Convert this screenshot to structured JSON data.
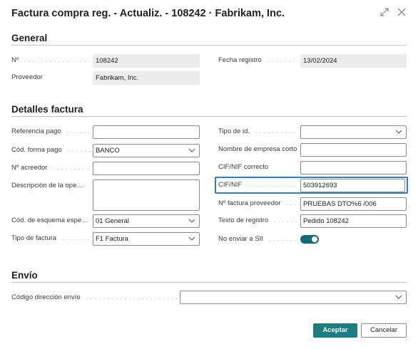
{
  "window": {
    "title": "Factura compra reg. - Actualiz. - 108242 · Fabrikam, Inc."
  },
  "icons": {
    "expand": "expand-icon",
    "close": "close-icon",
    "dropdown": "chevron-down-icon"
  },
  "colors": {
    "accent": "#1c7e82",
    "focus": "#2e7fc4",
    "toggle_on": "#0f6e73"
  },
  "general": {
    "title": "General",
    "no_label": "Nº",
    "no_value": "108242",
    "fecha_label": "Fecha registro",
    "fecha_value": "13/02/2024",
    "proveedor_label": "Proveedor",
    "proveedor_value": "Fabrikam, Inc."
  },
  "detalles": {
    "title": "Detalles factura",
    "referencia_pago": {
      "label": "Referencia pago",
      "value": ""
    },
    "cod_forma_pago": {
      "label": "Cód. forma pago",
      "value": "BANCO"
    },
    "no_acreedor": {
      "label": "Nº acreedor",
      "value": ""
    },
    "descripcion": {
      "label": "Descripción de la operación",
      "value": ""
    },
    "cod_esquema": {
      "label": "Cód. de esquema especial",
      "value": "01 General"
    },
    "tipo_factura": {
      "label": "Tipo de factura",
      "value": "F1 Factura"
    },
    "tipo_id": {
      "label": "Tipo de id.",
      "value": ""
    },
    "nombre_empresa": {
      "label": "Nombre de empresa corto",
      "value": ""
    },
    "cif_correcto": {
      "label": "CIF/NIF correcto",
      "value": ""
    },
    "cif_nif": {
      "label": "CIF/NIF",
      "value": "503912693"
    },
    "no_factura_proveedor": {
      "label": "Nº factura proveedor",
      "value": "PRUEBAS DTO%6 /006"
    },
    "texto_registro": {
      "label": "Texto de registro",
      "value": "Pedido 108242"
    },
    "no_enviar_sii": {
      "label": "No enviar a SII",
      "value": true
    }
  },
  "envio": {
    "title": "Envío",
    "codigo_direccion": {
      "label": "Código dirección envío",
      "value": ""
    }
  },
  "buttons": {
    "accept": "Aceptar",
    "cancel": "Cancelar"
  }
}
